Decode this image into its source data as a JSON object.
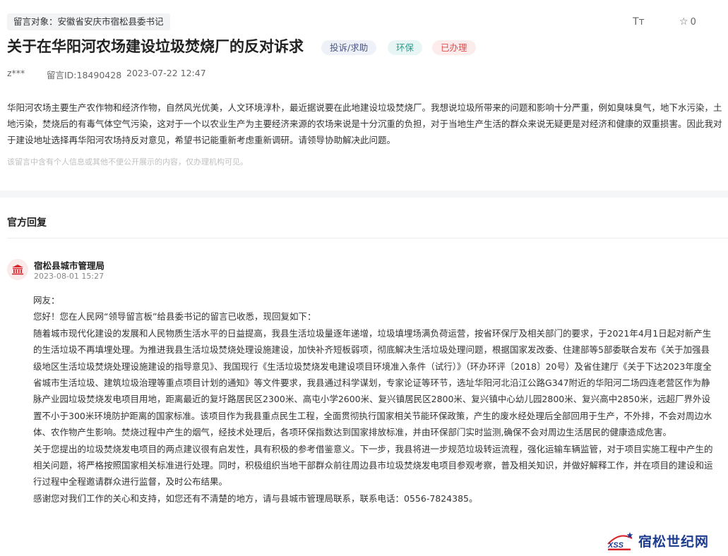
{
  "message": {
    "target_label": "留言对象：安徽省安庆市宿松县委书记",
    "title": "关于在华阳河农场建设垃圾焚烧厂的反对诉求",
    "tags": {
      "type": "投诉/求助",
      "field": "环保",
      "status": "已办理"
    },
    "author": "z***",
    "id_text": "留言ID:18490428",
    "date": "2023-07-22 12:47",
    "body": "华阳河农场主要生产农作物和经济作物，自然风光优美，人文环境淳朴，最近据说要在此地建设垃圾焚烧厂。我想说垃圾所带来的问题和影响十分严重，例如臭味臭气，地下水污染，土地污染，焚烧后的有毒气体空气污染，这对于一个以农业生产为主要经济来源的农场来说是十分沉重的负担，对于当地生产生活的群众来说无疑更是对经济和健康的双重损害。因此我对于建设地址选择再华阳河农场持反对意见，希望书记能重新考虑重新调研。请领导协助解决此问题。",
    "privacy_note": "该留言中含有个人信息或其他不便公开展示的内容，仅办理机构可见。"
  },
  "toolbar": {
    "font_icon": "Tт",
    "favorite_count": "0"
  },
  "reply": {
    "heading": "官方回复",
    "org_name": "宿松县城市管理局",
    "date": "2023-08-01 15:27",
    "paragraphs": [
      "网友：",
      "您好！您在人民网“领导留言板”给县委书记的留言已收悉，现回复如下：",
      "随着城市现代化建设的发展和人民物质生活水平的日益提高，我县生活垃圾量逐年递增，垃圾填埋场满负荷运营，按省环保厅及相关部门的要求，于2021年4月1日起对新产生的生活垃圾不再填埋处理。为推进我县生活垃圾焚烧处理设施建设，加快补齐短板弱项，彻底解决生活垃圾处理问题，根据国家发改委、住建部等5部委联合发布《关于加强县级地区生活垃圾焚烧处理设施建设的指导意见》、我国现行《生活垃圾焚烧发电建设项目环境准入条件（试行）》（环办环评〔2018〕20号）及省住建厅《关于下达2023年度全省城市生活垃圾、建筑垃圾治理等重点项目计划的通知》等文件要求，我县通过科学谋划，专家论证等环节，选址华阳河北沿江公路G347附近的华阳河二场四连老营区作为静脉产业园垃圾焚烧发电项目用地，距离最近的复圩路居民区2300米、高屯小学2600米、复兴镇居民区2800米、复兴镇中心幼儿园2800米、复兴高中2850米，远超厂界外设置不小于300米环境防护距离的国家标准。该项目作为我县重点民生工程，全面贯彻执行国家相关节能环保政策，产生的废水经处理后全部回用于生产，不外排，不会对周边水体、农作物产生影响。焚烧过程中产生的烟气，经技术处理后，各项环保指数达到国家排放标准，并由环保部门实时监测,确保不会对周边生活居民的健康造成危害。",
      "关于您提出的垃圾焚烧发电项目的两点建议很有启发性，具有积极的参考借鉴意义。下一步，我县将进一步规范垃圾转运流程，强化运输车辆监管，对于项目实施工程中产生的相关问题，将严格按照国家相关标准进行处理。同时，积极组织当地干部群众前往周边县市垃圾焚烧发电项目参观考察，普及相关知识，并做好解释工作，并在项目的建设和运行过程中全程邀请群众进行监督，及时公布结果。",
      "感谢您对我们工作的关心和支持，如您还有不清楚的地方，请与县城市管理局联系，联系电话：0556-7824385。"
    ]
  },
  "watermark": {
    "logo_text": "XSS",
    "site_name": "宿松世纪网"
  },
  "colors": {
    "tag_type_bg": "#eef1f8",
    "tag_field_bg": "#e7f6f4",
    "tag_status_bg": "#fdecec",
    "status_text": "#e24c4c",
    "brand_blue": "#1d3c8f",
    "brand_red": "#d9232a"
  }
}
